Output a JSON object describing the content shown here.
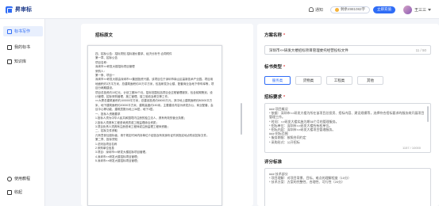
{
  "app": {
    "brand": "昇审标"
  },
  "header": {
    "notice_label": "通知",
    "balance_text": "剩余4981082字",
    "recharge_label": "立即充值",
    "username": "王三三"
  },
  "sidebar": {
    "items": [
      {
        "label": "标书写作",
        "icon": "pen-icon",
        "active": true
      },
      {
        "label": "我的标书",
        "icon": "file-icon",
        "active": false
      },
      {
        "label": "知识库",
        "icon": "book-icon",
        "active": false
      }
    ],
    "bottom_items": [
      {
        "label": "使用教程",
        "icon": "help-icon"
      },
      {
        "label": "收起",
        "icon": "collapse-icon"
      }
    ]
  },
  "center": {
    "title": "招标原文",
    "doc_lines": [
      "四、招标公告：招标须知 招标报价要求、经济分析书 合同附件",
      "第一章、招标公告",
      "项目名称：",
      "深圳市××研发大楼招标项目管理",
      "采购人：",
      "第一条、项目一",
      "深圳市××研发大楼由深圳市××集团投资兴建，该项目位于深圳市南山区高新技术产业园。项目用地面积约3万平方米，总建筑面积约20万平方米，包括研发办公楼、配套商业及地下停车库等，项目分两期建设。",
      "项目总投资约10亿元，计划工期36个月。招标范围包括项目全过程管理服务，包含前期策划、设计管理、招标采购管理、施工管理、竣工验收及移交等工作。",
      "××大厦总建筑面积约100000平方米，总建设投资约65000万元，其中地上建筑面积约80000平方米，地下建筑面积约20000平方米，建筑高度约150米。主要建设内容为研发办公、商业配套、会议中心等功能，建筑层数为地上36层，地下3层。",
      "一、投标人资格要求",
      "1.投标人须为中华人民共和国境内注册的独立法人，具有有效的营业执照；",
      "2.投标人须具有工程咨询资质或工程监理综合资质；",
      "3.项目负责人须具有注册咨询工程师或注册监理工程师资格；",
      "二、招标文件获取",
      "凡有意参加投标者，请于规定时间内持单位介绍信及有效身份证件到指定地点购买招标文件。",
      "第二章、投标须知",
      "1.总则及项目名称",
      "2.采购单位信息",
      "3.项目：深圳市××研发大楼招标项目管理。",
      "4.深圳市××研发大楼招标项目管理；",
      "5.深圳市××研发大楼招标项目管理；"
    ]
  },
  "right": {
    "name_label": "方案名称",
    "name_value": "深圳市××研发大楼招标项目管理委托经营投标文件",
    "name_count": "11 / 50",
    "type_label": "标书类型",
    "types": [
      "服务类",
      "货物类",
      "工程类",
      "其他"
    ],
    "selected_type": "服务类",
    "req_label": "招标要求",
    "req_lines": [
      "### 项目概况",
      "* 依据：深圳市××研发大楼为所在该项目总投资、招标内容、建设规模等，选择符合招标要求的服务商开展项目管理工作。",
      "* 时间：××研发大楼实施为期36个月的管理服务。",
      "* 招标单位：深圳市××研发大楼所有权单位。",
      "* 招标内容：深圳市××研发大楼项目管理服务。",
      "### 招标范围",
      "* 服务期限：按照合同约定",
      "* 采购形式：公开招标"
    ],
    "req_count": "1157 / 10000",
    "score_label": "评分标准",
    "score_lines": [
      "### 技术部分",
      "* 项目理解：对项目背景、目标、难点的理解程度（10分）",
      "* 技术方案：方案的完整性、合理性、可行性（20分）"
    ]
  }
}
